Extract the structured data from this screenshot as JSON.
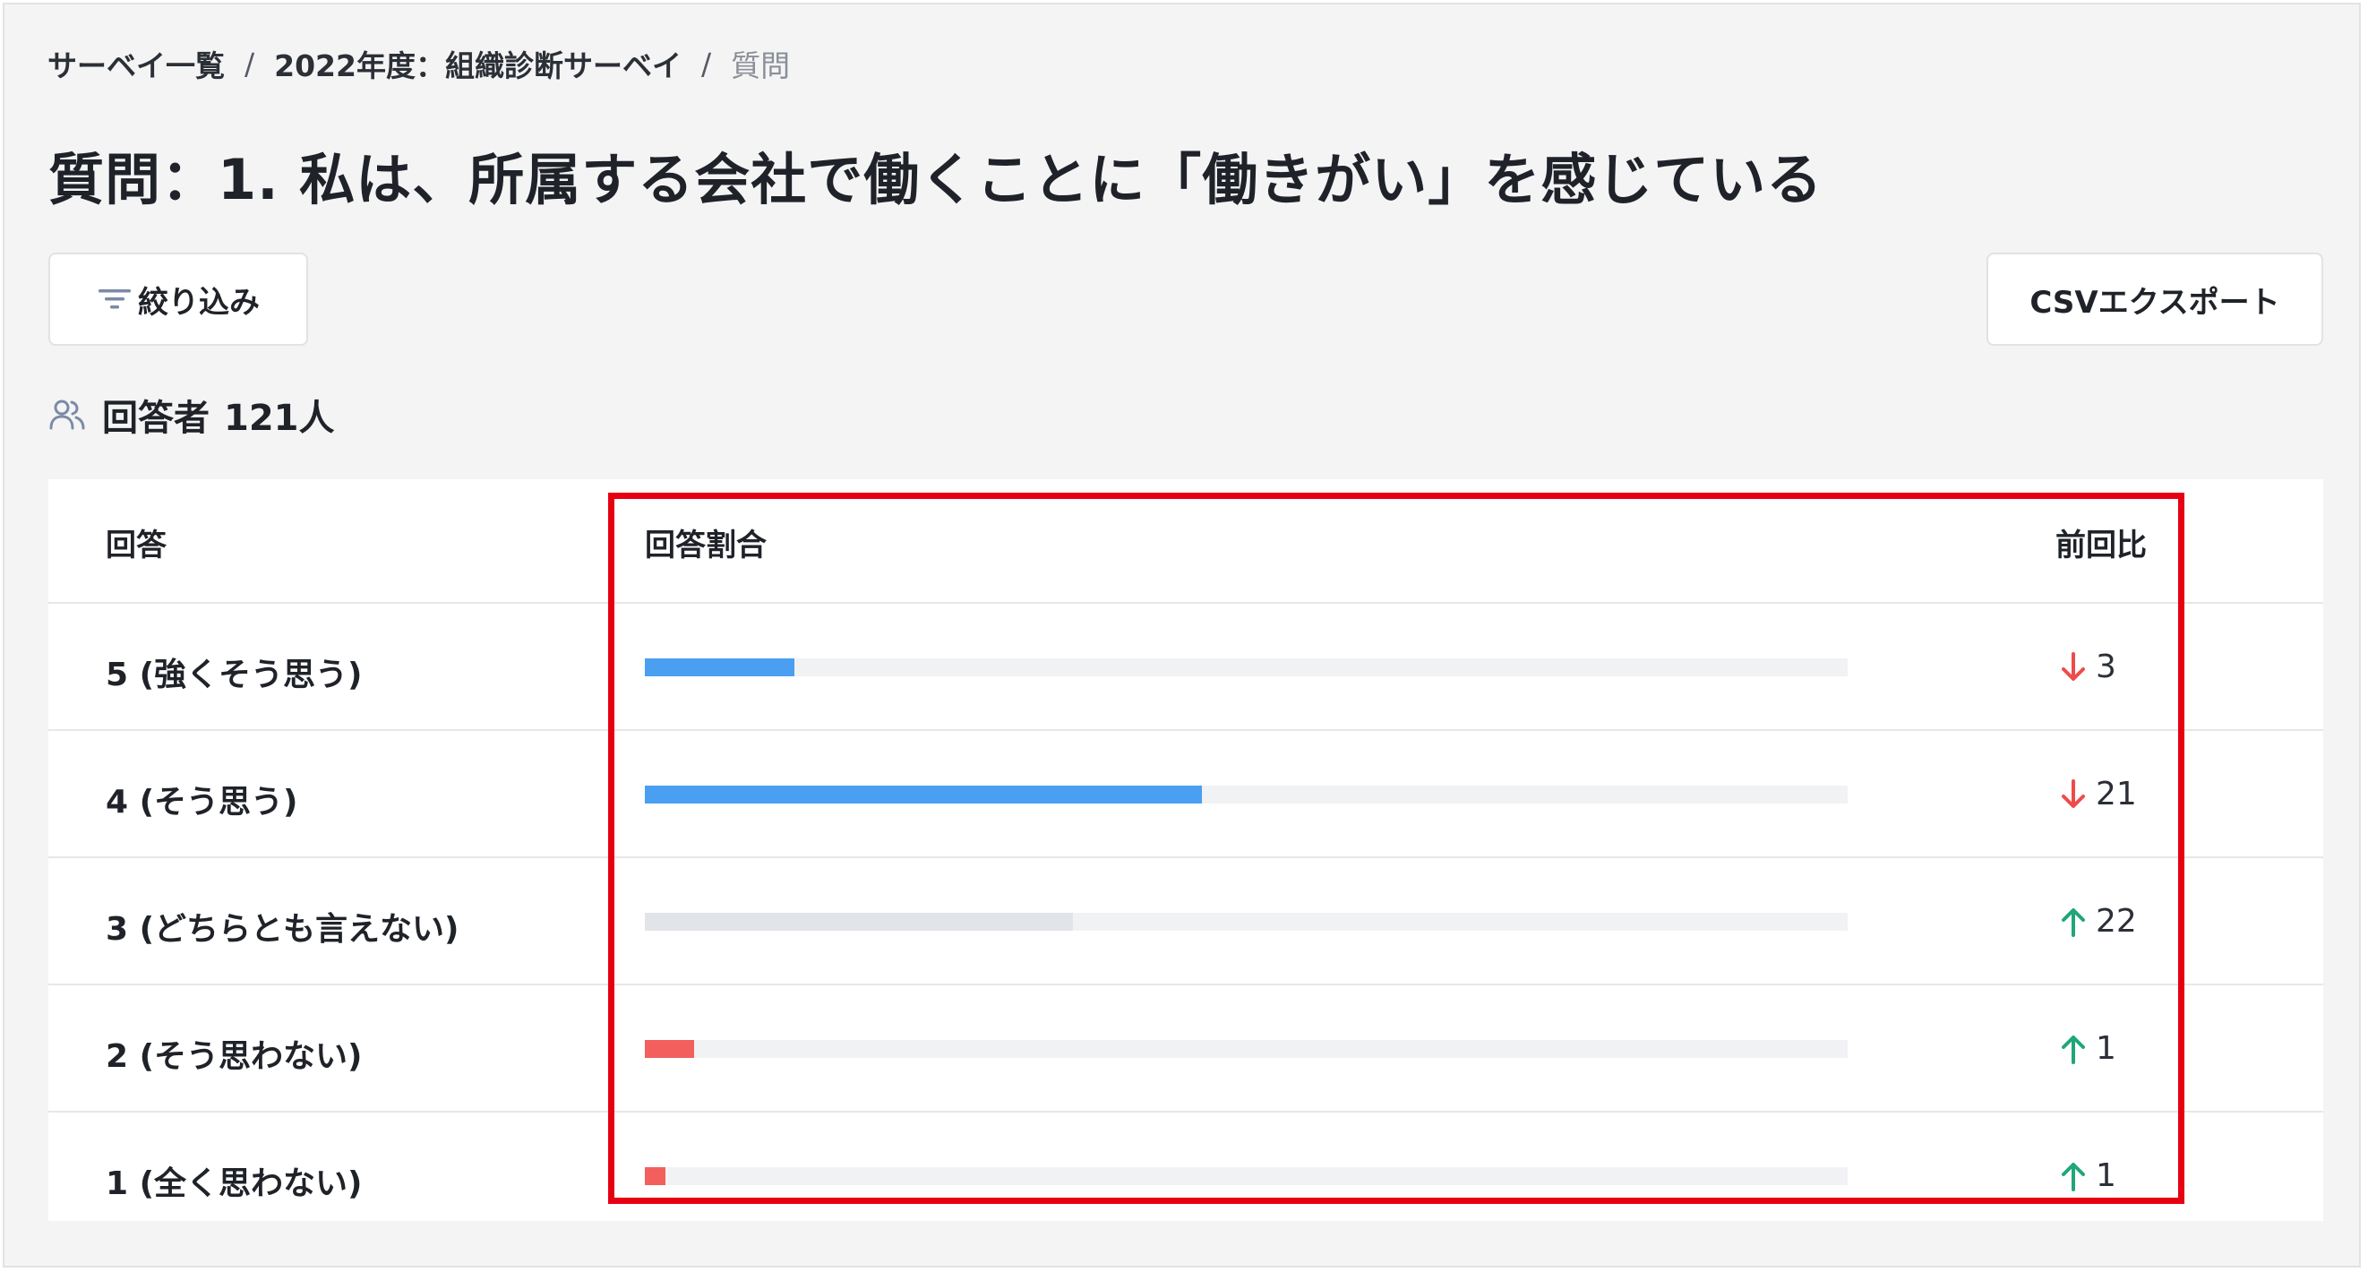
{
  "breadcrumb": {
    "items": [
      "サーベイ一覧",
      "2022年度：組織診断サーベイ"
    ],
    "current": "質問",
    "separator": "/"
  },
  "page_title": "質問：1. 私は、所属する会社で働くことに「働きがい」を感じている",
  "toolbar": {
    "filter_label": "絞り込み",
    "csv_label": "CSVエクスポート"
  },
  "respondents": {
    "label": "回答者",
    "count": "121人"
  },
  "table": {
    "headers": {
      "answer": "回答",
      "ratio": "回答割合",
      "diff": "前回比"
    },
    "rows": [
      {
        "answer": "5 (強くそう思う)",
        "ratio": 0.124,
        "bar_color": "#4a9ff0",
        "diff_direction": "down",
        "diff": "3"
      },
      {
        "answer": "4 (そう思う)",
        "ratio": 0.463,
        "bar_color": "#4a9ff0",
        "diff_direction": "down",
        "diff": "21"
      },
      {
        "answer": "3 (どちらとも言えない)",
        "ratio": 0.356,
        "bar_color": "#e1e4e8",
        "diff_direction": "up",
        "diff": "22"
      },
      {
        "answer": "2 (そう思わない)",
        "ratio": 0.041,
        "bar_color": "#f25f5c",
        "diff_direction": "up",
        "diff": "1"
      },
      {
        "answer": "1 (全く思わない)",
        "ratio": 0.017,
        "bar_color": "#f25f5c",
        "diff_direction": "up",
        "diff": "1"
      }
    ]
  },
  "colors": {
    "arrow_up": "#1fa67a",
    "arrow_down": "#ef4b4b",
    "highlight": "#e60012"
  }
}
